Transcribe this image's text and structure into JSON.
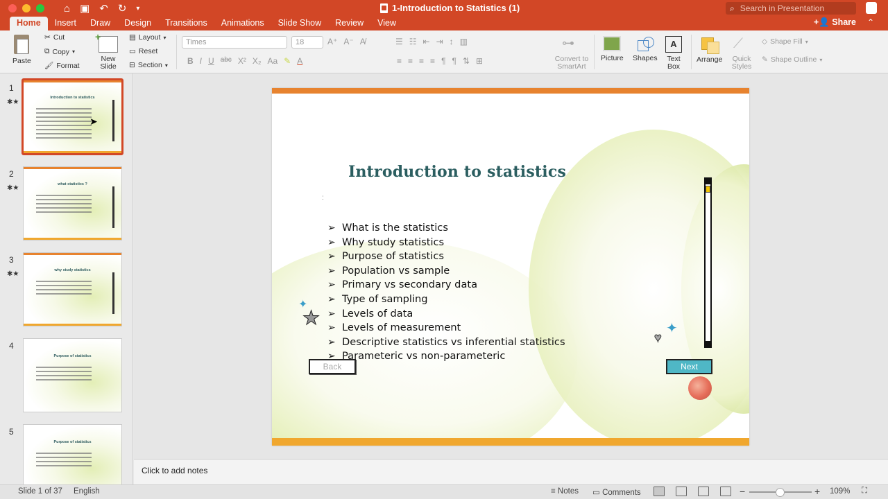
{
  "titlebar": {
    "doc_title": "1-Introduction to Statistics (1)",
    "search_placeholder": "Search in Presentation",
    "icons": [
      "home-icon",
      "save-icon",
      "undo-icon",
      "redo-icon",
      "customize-icon"
    ],
    "color": "#d24726"
  },
  "tabs": [
    "Home",
    "Insert",
    "Draw",
    "Design",
    "Transitions",
    "Animations",
    "Slide Show",
    "Review",
    "View"
  ],
  "share_label": "Share",
  "ribbon": {
    "paste": "Paste",
    "cut": "Cut",
    "copy": "Copy",
    "format": "Format",
    "new_slide": "New Slide",
    "layout": "Layout",
    "reset": "Reset",
    "section": "Section",
    "font_name": "Times",
    "font_size": "18",
    "convert_smartart": "Convert to SmartArt",
    "picture": "Picture",
    "shapes": "Shapes",
    "text_box": "Text Box",
    "arrange": "Arrange",
    "quick_styles": "Quick Styles",
    "shape_fill": "Shape Fill",
    "shape_outline": "Shape Outline"
  },
  "thumbnails": [
    {
      "num": "1",
      "title": "Introduction to statistics",
      "selected": true
    },
    {
      "num": "2",
      "title": "what statistics ?",
      "selected": false
    },
    {
      "num": "3",
      "title": "why study statistics",
      "selected": false
    },
    {
      "num": "4",
      "title": "Purpose of statistics",
      "selected": false
    },
    {
      "num": "5",
      "title": "Purpose of statistics",
      "selected": false
    }
  ],
  "slide": {
    "title": "Introduction to statistics",
    "colon": ":",
    "bullets": [
      "What is the statistics",
      "Why study statistics",
      "Purpose of statistics",
      " Population vs sample",
      "Primary vs secondary data",
      "  Type of sampling",
      "Levels  of data",
      "Levels of measurement",
      "Descriptive statistics vs inferential statistics",
      "Parameteric vs non-parameteric"
    ],
    "back_label": "Back",
    "next_label": "Next",
    "accent_top": "#e7832f",
    "accent_bottom": "#f0a72e",
    "next_color": "#4fb7c6"
  },
  "notes_placeholder": "Click to add notes",
  "status": {
    "slide_info": "Slide 1 of 37",
    "language": "English",
    "notes": "Notes",
    "comments": "Comments",
    "zoom": "109%"
  }
}
